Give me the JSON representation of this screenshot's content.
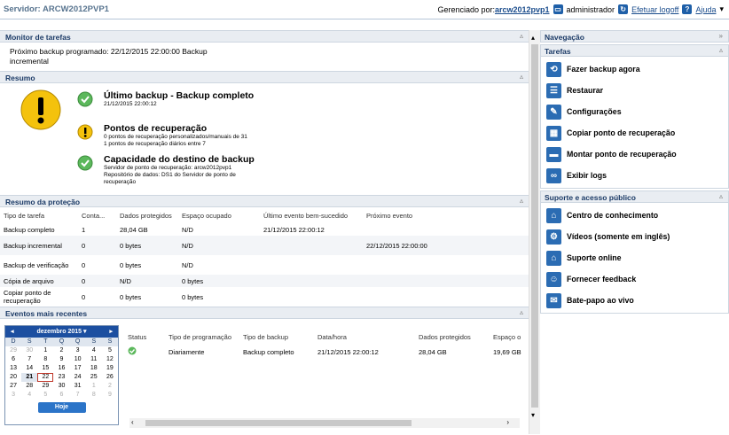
{
  "header": {
    "server": "Servidor: ARCW2012PVP1",
    "managed_prefix": "Gerenciado por:",
    "managed_link": "arcw2012pvp1",
    "user": "administrador",
    "logoff": "Efetuar logoff",
    "help": "Ajuda"
  },
  "task_monitor": {
    "title": "Monitor de tarefas",
    "line1": "Próximo backup programado: 22/12/2015 22:00:00 Backup",
    "line2": "incremental"
  },
  "summary": {
    "title": "Resumo",
    "last_backup": {
      "title": "Último backup - Backup completo",
      "date": "21/12/2015 22:00:12"
    },
    "recovery_points": {
      "title": "Pontos de recuperação",
      "l1": "0 pontos de recuperação personalizados/manuais de 31",
      "l2": "1 pontos de recuperação diários entre 7"
    },
    "capacity": {
      "title": "Capacidade do destino de backup",
      "l1": "Servidor de ponto de recuperação: arcw2012pvp1",
      "l2": "Repositório de dados: DS1 do Servidor de ponto de",
      "l3": "recuperação"
    }
  },
  "protection": {
    "title": "Resumo da proteção",
    "headers": [
      "Tipo de tarefa",
      "Conta...",
      "Dados protegidos",
      "Espaço ocupado",
      "Último evento bem-sucedido",
      "Próximo evento"
    ],
    "rows": [
      [
        "Backup completo",
        "1",
        "28,04 GB",
        "N/D",
        "21/12/2015 22:00:12",
        ""
      ],
      [
        "Backup incremental",
        "0",
        "0 bytes",
        "N/D",
        "",
        "22/12/2015 22:00:00"
      ],
      [
        "Backup de verificação",
        "0",
        "0 bytes",
        "N/D",
        "",
        ""
      ],
      [
        "Cópia de arquivo",
        "0",
        "N/D",
        "0 bytes",
        "",
        ""
      ],
      [
        "Copiar ponto de recuperação",
        "0",
        "0 bytes",
        "0 bytes",
        "",
        ""
      ]
    ]
  },
  "events": {
    "title": "Eventos mais recentes",
    "headers": [
      "Status",
      "Tipo de programação",
      "Tipo de backup",
      "Data/hora",
      "Dados protegidos",
      "Espaço o"
    ],
    "row": [
      "",
      "Diariamente",
      "Backup completo",
      "21/12/2015 22:00:12",
      "28,04 GB",
      "19,69 GB"
    ]
  },
  "calendar": {
    "month": "dezembro 2015",
    "dow": [
      "D",
      "S",
      "T",
      "Q",
      "Q",
      "S",
      "S"
    ],
    "days": [
      "29",
      "30",
      "1",
      "2",
      "3",
      "4",
      "5",
      "6",
      "7",
      "8",
      "9",
      "10",
      "11",
      "12",
      "13",
      "14",
      "15",
      "16",
      "17",
      "18",
      "19",
      "20",
      "21",
      "22",
      "23",
      "24",
      "25",
      "26",
      "27",
      "28",
      "29",
      "30",
      "31",
      "1",
      "2",
      "3",
      "4",
      "5",
      "6",
      "7",
      "8",
      "9"
    ],
    "today": "Hoje"
  },
  "nav": {
    "title": "Navegação",
    "tasks_title": "Tarefas",
    "tasks": [
      "Fazer backup agora",
      "Restaurar",
      "Configurações",
      "Copiar ponto de recuperação",
      "Montar ponto de recuperação",
      "Exibir logs"
    ],
    "support_title": "Suporte e acesso público",
    "support": [
      "Centro de conhecimento",
      "Vídeos (somente em inglês)",
      "Suporte online",
      "Fornecer feedback",
      "Bate-papo ao vivo"
    ]
  }
}
